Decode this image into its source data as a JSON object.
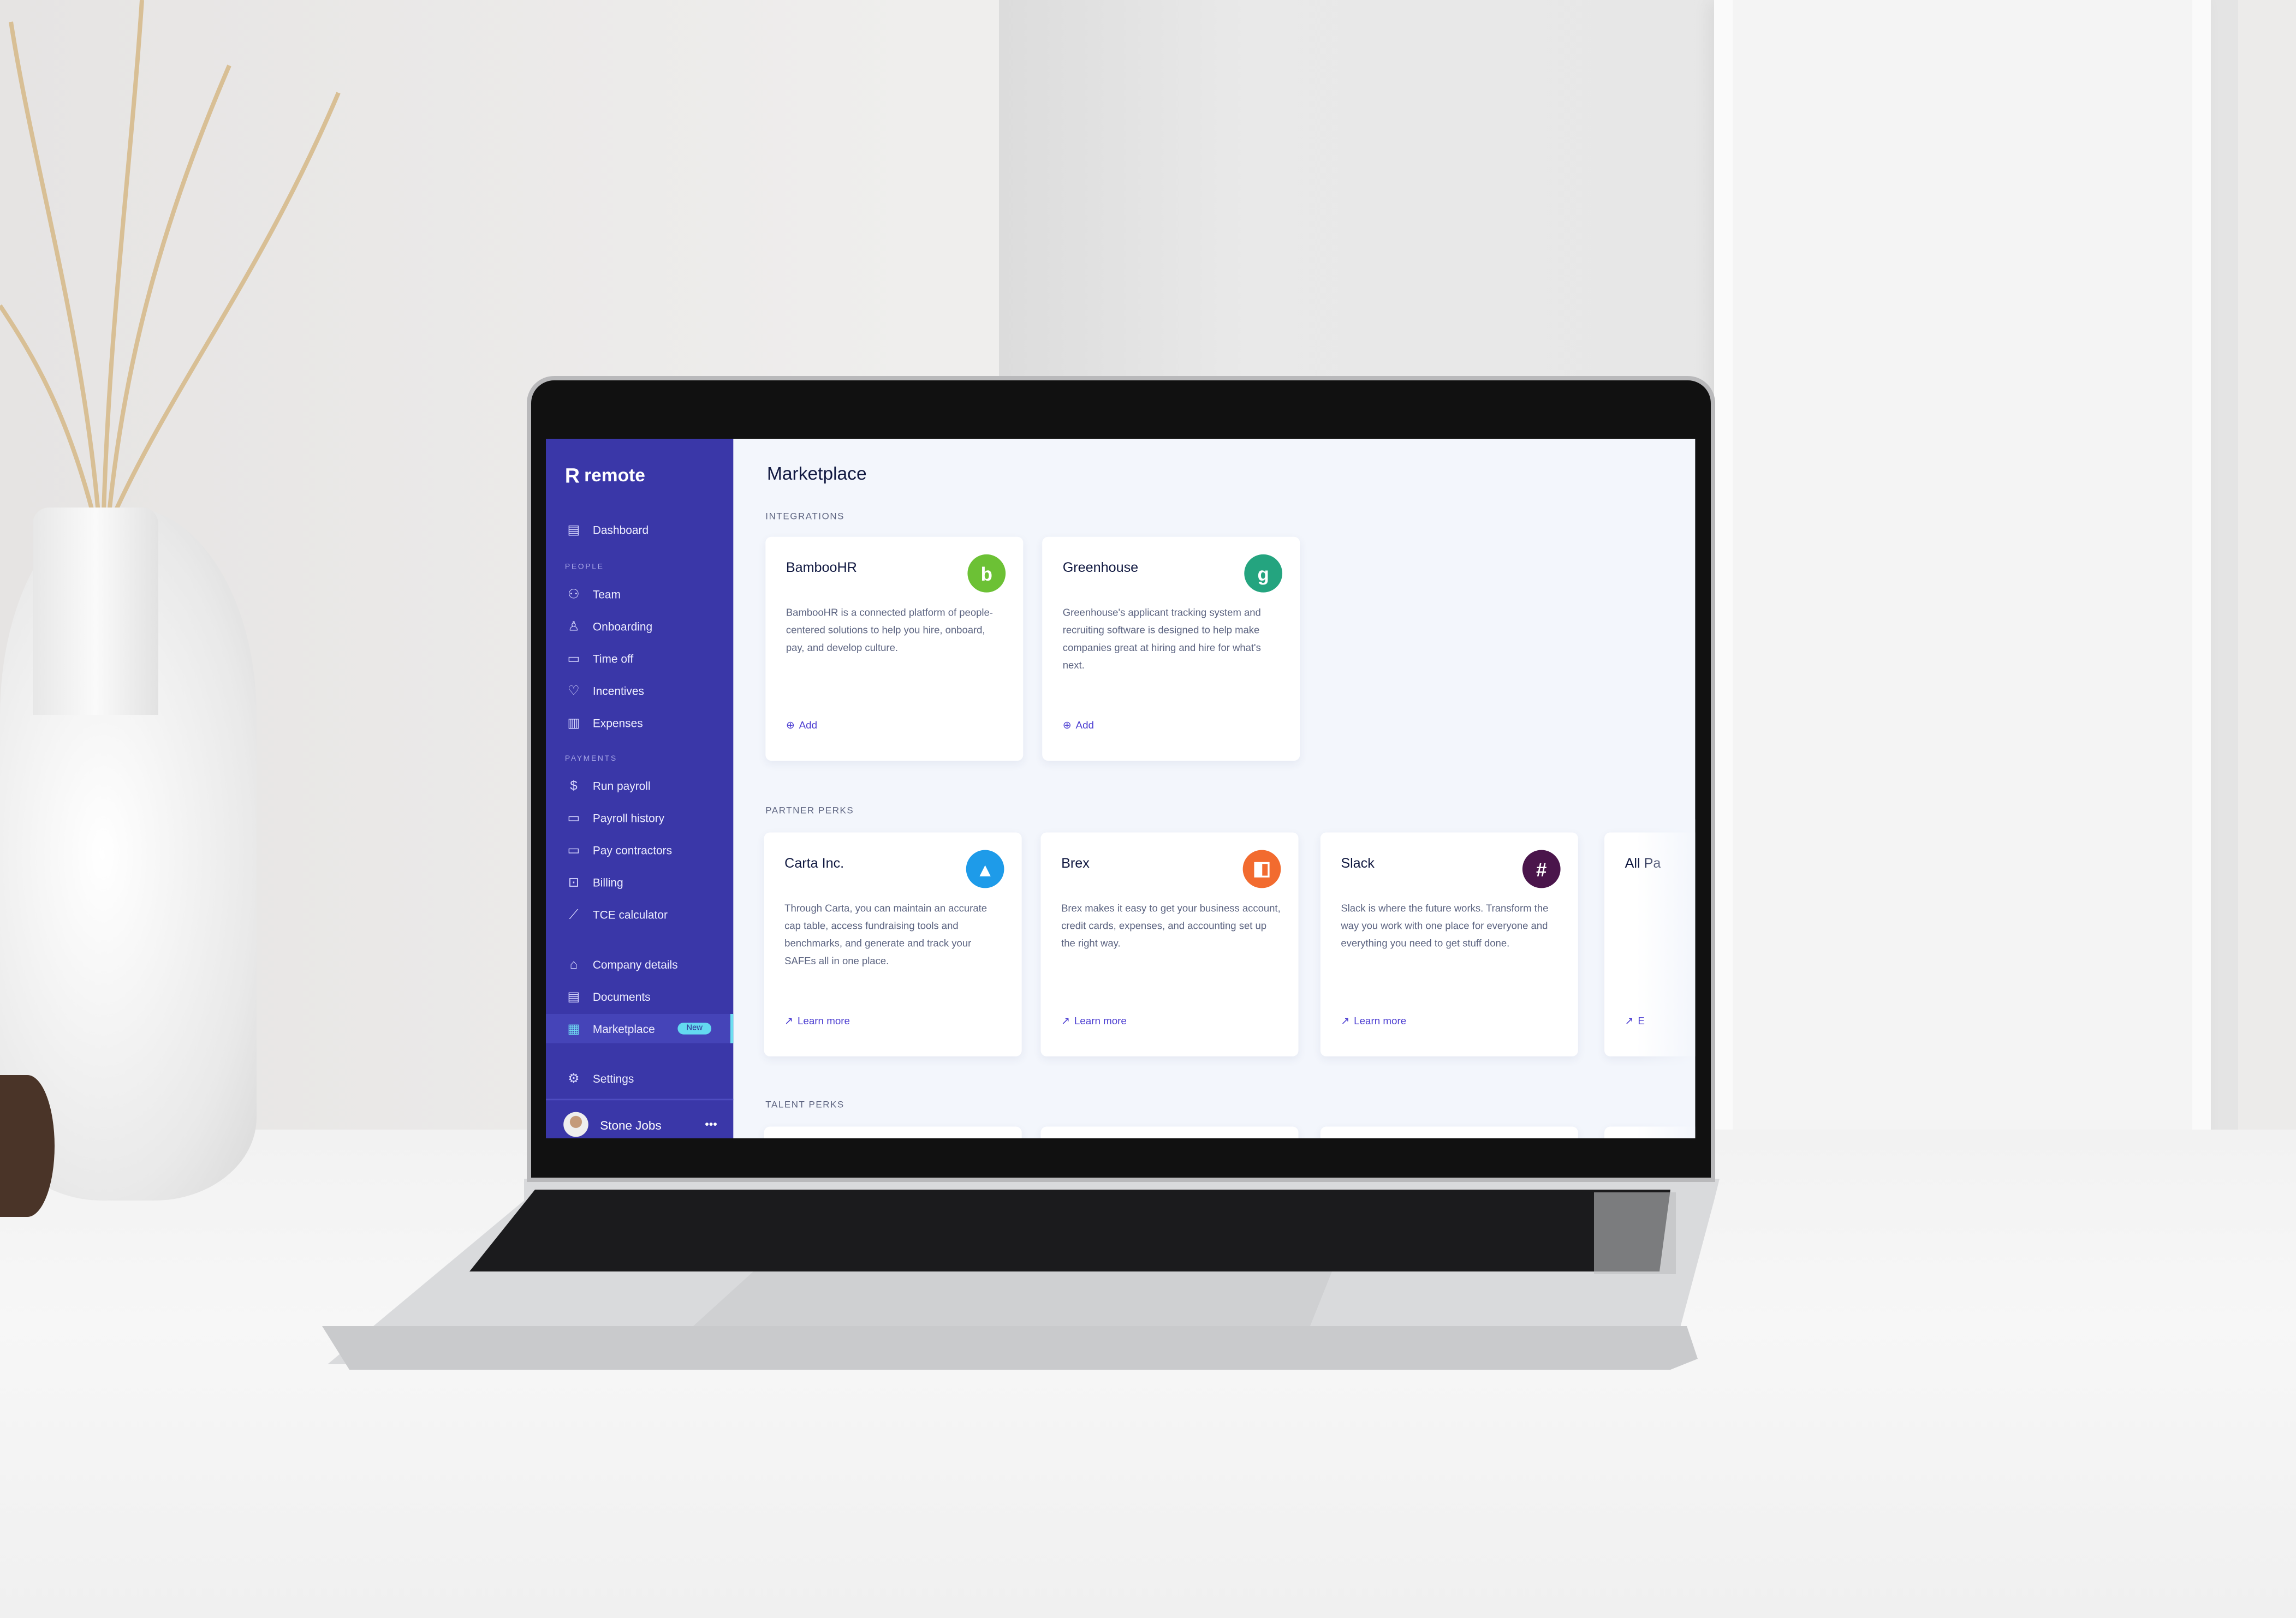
{
  "app": {
    "brand": "remote",
    "page_title": "Marketplace",
    "accent": "#3a37a8",
    "badge_color": "#63d9f0"
  },
  "sidebar": {
    "items": [
      {
        "label": "Dashboard",
        "icon": "dashboard-icon"
      },
      {
        "section": "PEOPLE"
      },
      {
        "label": "Team",
        "icon": "team-icon"
      },
      {
        "label": "Onboarding",
        "icon": "user-plus-icon"
      },
      {
        "label": "Time off",
        "icon": "calendar-icon"
      },
      {
        "label": "Incentives",
        "icon": "heart-icon"
      },
      {
        "label": "Expenses",
        "icon": "receipt-icon"
      },
      {
        "section": "PAYMENTS"
      },
      {
        "label": "Run payroll",
        "icon": "dollar-icon"
      },
      {
        "label": "Payroll history",
        "icon": "calendar-dollar-icon"
      },
      {
        "label": "Pay contractors",
        "icon": "credit-card-icon"
      },
      {
        "label": "Billing",
        "icon": "bill-icon"
      },
      {
        "label": "TCE calculator",
        "icon": "chart-line-icon"
      },
      {
        "label": "Company details",
        "icon": "building-icon"
      },
      {
        "label": "Documents",
        "icon": "document-icon"
      },
      {
        "label": "Marketplace",
        "icon": "grid-icon",
        "badge": "New",
        "active": true
      },
      {
        "label": "Settings",
        "icon": "gear-icon"
      }
    ],
    "user": {
      "name": "Stone Jobs"
    }
  },
  "sections": {
    "integrations": {
      "label": "INTEGRATIONS",
      "cards": [
        {
          "name": "BambooHR",
          "description": "BambooHR is a connected platform of people-centered solutions to help you hire, onboard, pay, and develop culture.",
          "action": "Add",
          "color": "#6cc135"
        },
        {
          "name": "Greenhouse",
          "description": "Greenhouse's applicant tracking system and recruiting software is designed to help make companies great at hiring and hire for what's next.",
          "action": "Add",
          "color": "#24a47f"
        }
      ]
    },
    "partner_perks": {
      "label": "PARTNER PERKS",
      "cards": [
        {
          "name": "Carta Inc.",
          "description": "Through Carta, you can maintain an accurate cap table, access fundraising tools and benchmarks, and generate and track your SAFEs all in one place.",
          "action": "Learn more",
          "color": "#1e9be9"
        },
        {
          "name": "Brex",
          "description": "Brex makes it easy to get your business account, credit cards, expenses, and accounting set up the right way.",
          "action": "Learn more",
          "color": "#f26b2f"
        },
        {
          "name": "Slack",
          "description": "Slack is where the future works. Transform the way you work with one place for everyone and everything you need to get stuff done.",
          "action": "Learn more",
          "color": "#4a154b"
        },
        {
          "name": "All Pa",
          "description": "",
          "action": "E",
          "color": "#ffffff"
        }
      ]
    },
    "talent_perks": {
      "label": "TALENT PERKS"
    }
  }
}
